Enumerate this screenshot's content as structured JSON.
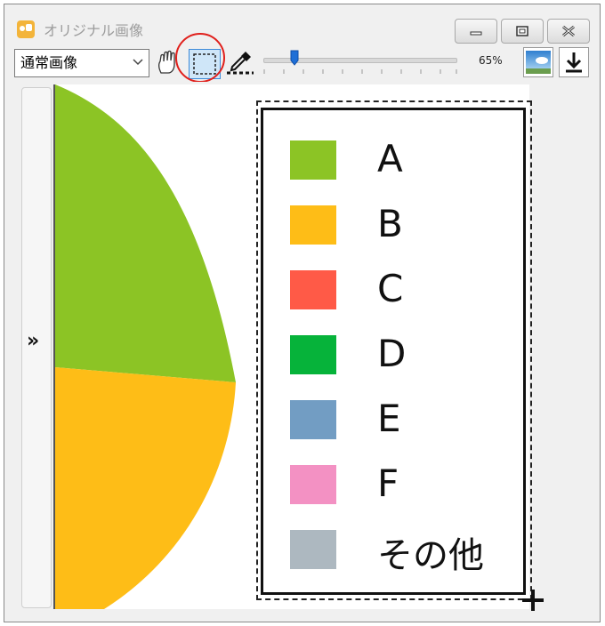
{
  "window": {
    "title": "オリジナル画像"
  },
  "toolbar": {
    "view_mode": "通常画像",
    "zoom_label": "65%",
    "zoom_level_percent": 65,
    "selected_tool": "selection-rectangle"
  },
  "side_panel": {
    "toggle_label": "»"
  },
  "chart_data": {
    "type": "pie",
    "legend": [
      {
        "label": "A",
        "color": "#8cc425"
      },
      {
        "label": "B",
        "color": "#febd17"
      },
      {
        "label": "C",
        "color": "#ff5a47"
      },
      {
        "label": "D",
        "color": "#06b33a"
      },
      {
        "label": "E",
        "color": "#729dc3"
      },
      {
        "label": "F",
        "color": "#f391c3"
      },
      {
        "label": "その他",
        "color": "#adb8c0"
      }
    ]
  },
  "icons": {
    "minimize": "minimize-icon",
    "restore": "restore-icon",
    "close": "close-icon",
    "hand": "hand-icon",
    "select": "selection-rect-icon",
    "eyedropper": "eyedropper-icon",
    "image": "image-icon",
    "download": "download-icon"
  }
}
